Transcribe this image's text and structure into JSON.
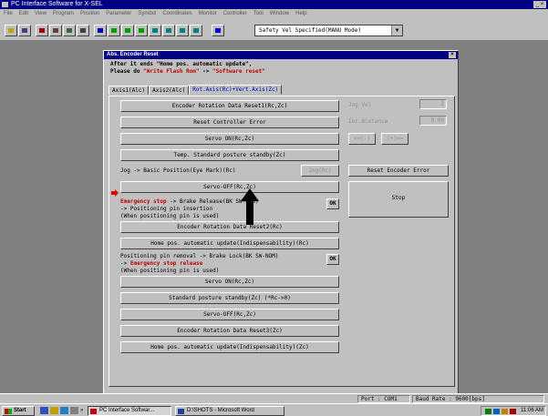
{
  "window": {
    "title": "PC Interface Software for X-SEL"
  },
  "menu": [
    "File",
    "Edit",
    "View",
    "Program",
    "Position",
    "Parameter",
    "Symbol",
    "Coordinates",
    "Monitor",
    "Controller",
    "Tool",
    "Window",
    "Help"
  ],
  "toolbar": {
    "mode_value": "Safety Vel Specified(MANU Mode)",
    "dropdown_arrow": "▼"
  },
  "dialog": {
    "title": "Abs. Encoder Reset",
    "close": "×",
    "instr_line1": "After it ends \"Home pos. automatic update\",",
    "instr_line2_prefix": "Please do ",
    "instr_line2_red1": "\"Write Flash Rom\"",
    "instr_line2_mid": " -> ",
    "instr_line2_red2": "\"Software reset\"",
    "tabs": [
      "Axis1(Alc)",
      "Axis2(Alc)",
      "Rot.Axis(Rc)+Vert.Axis(Zc)"
    ],
    "buttons": {
      "enc_reset1": "Encoder Rotation Data Reset1(Rc,Zc)",
      "reset_err": "Reset Controller Error",
      "servo_on1": "Servo ON(Rc,Zc)",
      "temp_standby": "Temp. Standard posture standby(Zc)",
      "jog_action": "Jog(Rc)",
      "servo_off1": "Servo-OFF(Rc,Zc)",
      "ok1": "OK",
      "enc_reset2": "Encoder Rotation Data Reset2(Rc)",
      "home_update1": "Home pos. automatic update(Indispensability)(Rc)",
      "ok2": "OK",
      "servo_on2": "Servo ON(Rc,Zc)",
      "standby": "Standard posture standby(Zc) (*Rc->0)",
      "servo_off2": "Servo-OFF(Rc,Zc)",
      "enc_reset3": "Encoder Rotation Data Reset3(Zc)",
      "home_update2": "Home pos. automatic update(Indispensability)(Zc)",
      "jog_minus": "<<(-)",
      "jog_plus": "(+)>>",
      "reset_enc_err": "Reset Encoder Error",
      "stop": "Stop"
    },
    "labels": {
      "jog_basic": "Jog -> Basic Position(Eye Mark)(Rc)",
      "emg_red": "Emergency stop",
      "emg_rest": " -> Brake Release(BK SW-RLS)",
      "pin_insert": " -> Positioning pin insertion",
      "when1": "(When positioning pin is used)",
      "pin_remove": "Positioning pin removal -> Brake Lock(BK SW-NOM)",
      "emg_release_pre": " -> ",
      "emg_release_red": "Emergency stop release",
      "when2": "(When positioning pin is used)",
      "jog_vel_label": "Jog Vel",
      "jog_vel_value": "2",
      "inc_dist_label": "Inc.Distance",
      "inc_dist_value": "0.00"
    }
  },
  "status": {
    "port": "Port : COM1",
    "baud": "Baud Rate : 9600[bps]"
  },
  "taskbar": {
    "start": "Start",
    "quick_more": "»",
    "task1": "PC Interface Softwar...",
    "task2": "D:\\SHOTS - Microsoft Word",
    "clock": "11:06 AM"
  }
}
